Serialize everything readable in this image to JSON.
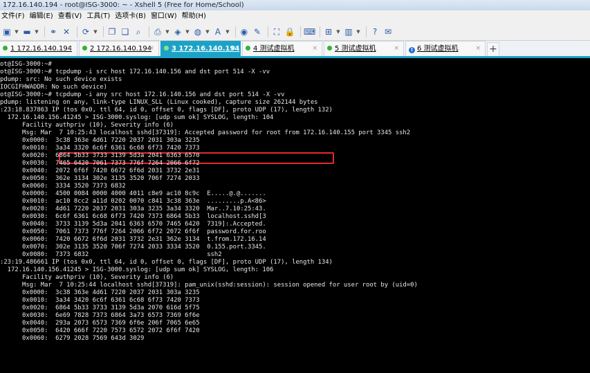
{
  "window": {
    "title": "172.16.140.194 - root@ISG-3000: ~ - Xshell 5 (Free for Home/School)"
  },
  "menu": [
    "文件(F)",
    "编辑(E)",
    "查看(V)",
    "工具(T)",
    "选项卡(B)",
    "窗口(W)",
    "帮助(H)"
  ],
  "toolbar": [
    {
      "icon": "new-session-icon",
      "glyph": "▣",
      "arrow": true
    },
    {
      "icon": "open-folder-icon",
      "glyph": "▬",
      "arrow": true
    },
    {
      "icon": "sep"
    },
    {
      "icon": "link-icon",
      "glyph": "⚭",
      "arrow": false
    },
    {
      "icon": "disconnect-icon",
      "glyph": "✕",
      "arrow": false
    },
    {
      "icon": "sep"
    },
    {
      "icon": "reconnect-icon",
      "glyph": "⟳",
      "arrow": true
    },
    {
      "icon": "sep"
    },
    {
      "icon": "copy-icon",
      "glyph": "❐",
      "arrow": false
    },
    {
      "icon": "paste-icon",
      "glyph": "❑",
      "arrow": false
    },
    {
      "icon": "find-icon",
      "glyph": "⌕",
      "arrow": false
    },
    {
      "icon": "sep"
    },
    {
      "icon": "print-icon",
      "glyph": "⎙",
      "arrow": true
    },
    {
      "icon": "properties-icon",
      "glyph": "◈",
      "arrow": true
    },
    {
      "icon": "globe-icon",
      "glyph": "◍",
      "arrow": true
    },
    {
      "icon": "font-icon",
      "glyph": "A",
      "arrow": true
    },
    {
      "icon": "sep"
    },
    {
      "icon": "xftp-icon",
      "glyph": "◉",
      "arrow": false
    },
    {
      "icon": "script-icon",
      "glyph": "✎",
      "arrow": false
    },
    {
      "icon": "sep"
    },
    {
      "icon": "fullscreen-icon",
      "glyph": "⛶",
      "arrow": false
    },
    {
      "icon": "lock-icon",
      "glyph": "🔒",
      "arrow": false
    },
    {
      "icon": "sep"
    },
    {
      "icon": "keyboard-icon",
      "glyph": "⌨",
      "arrow": false
    },
    {
      "icon": "sep"
    },
    {
      "icon": "add-icon",
      "glyph": "⊞",
      "arrow": true
    },
    {
      "icon": "layout-icon",
      "glyph": "▥",
      "arrow": true
    },
    {
      "icon": "sep"
    },
    {
      "icon": "help-icon",
      "glyph": "?",
      "arrow": false
    },
    {
      "icon": "chat-icon",
      "glyph": "✉",
      "arrow": false
    }
  ],
  "tabs": [
    {
      "label": "1 172.16.140.194",
      "status": "ok",
      "active": false
    },
    {
      "label": "2 172.16.140.194",
      "status": "ok",
      "active": false
    },
    {
      "label": "3 172.16.140.194",
      "status": "ok",
      "active": true
    },
    {
      "label": "4 测试虚拟机",
      "status": "ok",
      "active": false
    },
    {
      "label": "5 测试虚拟机",
      "status": "ok",
      "active": false
    },
    {
      "label": "6 测试虚拟机",
      "status": "warn",
      "active": false
    }
  ],
  "terminal_lines": [
    "ot@ISG-3000:~#",
    "ot@ISG-3000:~# tcpdump -i src host 172.16.140.156 and dst port 514 -X -vv",
    "pdump: src: No such device exists",
    "IOCGIFHWADDR: No such device)",
    "ot@ISG-3000:~# tcpdump -i any src host 172.16.140.156 and dst port 514 -X -vv",
    "pdump: listening on any, link-type LINUX_SLL (Linux cooked), capture size 262144 bytes",
    ":23:18.837863 IP (tos 0x0, ttl 64, id 0, offset 0, flags [DF], proto UDP (17), length 132)",
    "  172.16.140.156.41245 > ISG-3000.syslog: [udp sum ok] SYSLOG, length: 104",
    "      Facility authpriv (10), Severity info (6)",
    "      Msg: Mar  7 10:25:43 localhost sshd[37319]: Accepted password for root from 172.16.140.155 port 3345 ssh2",
    "      0x0000:  3c38 363e 4d61 7220 2037 2031 303a 3235",
    "      0x0010:  3a34 3320 6c6f 6361 6c68 6f73 7420 7373",
    "      0x0020:  6864 5b33 3733 3139 5d3a 2041 6363 6570",
    "      0x0030:  7465 6420 7061 7373 776f 7264 2066 6f72",
    "      0x0040:  2072 6f6f 7420 6672 6f6d 2031 3732 2e31",
    "      0x0050:  362e 3134 302e 3135 3520 706f 7274 2033",
    "      0x0060:  3334 3520 7373 6832",
    "      0x0000:  4500 0084 0000 4000 4011 c8e9 ac10 8c9c  E.....@.@.......",
    "      0x0010:  ac10 8cc2 a11d 0202 0070 c841 3c38 363e  .........p.A<86>",
    "      0x0020:  4d61 7220 2037 2031 303a 3235 3a34 3320  Mar..7.10:25:43.",
    "      0x0030:  6c6f 6361 6c68 6f73 7420 7373 6864 5b33  localhost.sshd[3",
    "      0x0040:  3733 3139 5d3a 2041 6363 6570 7465 6420  7319]:.Accepted.",
    "      0x0050:  7061 7373 776f 7264 2066 6f72 2072 6f6f  password.for.roo",
    "      0x0060:  7420 6672 6f6d 2031 3732 2e31 362e 3134  t.from.172.16.14",
    "      0x0070:  302e 3135 3520 706f 7274 2033 3334 3520  0.155.port.3345.",
    "      0x0080:  7373 6832                                ssh2",
    ":23:19.486661 IP (tos 0x0, ttl 64, id 0, offset 0, flags [DF], proto UDP (17), length 134)",
    "  172.16.140.156.41245 > ISG-3000.syslog: [udp sum ok] SYSLOG, length: 106",
    "      Facility authpriv (10), Severity info (6)",
    "      Msg: Mar  7 10:25:44 localhost sshd[37319]: pam_unix(sshd:session): session opened for user root by (uid=0)",
    "      0x0000:  3c38 363e 4d61 7220 2037 2031 303a 3235",
    "      0x0010:  3a34 3420 6c6f 6361 6c68 6f73 7420 7373",
    "      0x0020:  6864 5b33 3733 3139 5d3a 2070 616d 5f75",
    "      0x0030:  6e69 7828 7373 6864 3a73 6573 7369 6f6e",
    "      0x0040:  293a 2073 6573 7369 6f6e 206f 7065 6e65",
    "      0x0050:  6420 666f 7220 7573 6572 2072 6f6f 7420",
    "      0x0060:  6279 2028 7569 643d 3029"
  ],
  "colors": {
    "terminal_bg": "#000000",
    "terminal_fg": "#e8e8e8",
    "active_tab": "#1ba3c7",
    "highlight": "#e8282e"
  }
}
